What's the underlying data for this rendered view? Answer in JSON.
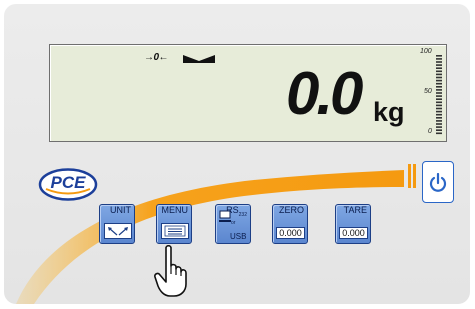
{
  "display": {
    "zero_indicator": "→0←",
    "weight": "0.0",
    "unit": "kg",
    "bar_scale": {
      "max": "100",
      "mid": "50",
      "min": "0"
    }
  },
  "brand": {
    "logo_text": "PCE"
  },
  "keys": {
    "unit": "UNIT",
    "menu": "MENU",
    "rs": "RS",
    "rs_sub": "232",
    "or": "or",
    "usb": "USB",
    "zero": "ZERO",
    "zero_value": "0.000",
    "tare": "TARE",
    "tare_value": "0.000"
  },
  "colors": {
    "lcd": "#e7ecd9",
    "key_blue": "#6a92d8",
    "swoosh": "#f5a623",
    "logo_blue": "#1c3f9a",
    "power_blue": "#2a66c7"
  },
  "icons": [
    "stable-arrow-icon",
    "power-icon",
    "unit-arrows-icon",
    "menu-paper-icon",
    "computer-icon",
    "pointing-hand-icon"
  ]
}
